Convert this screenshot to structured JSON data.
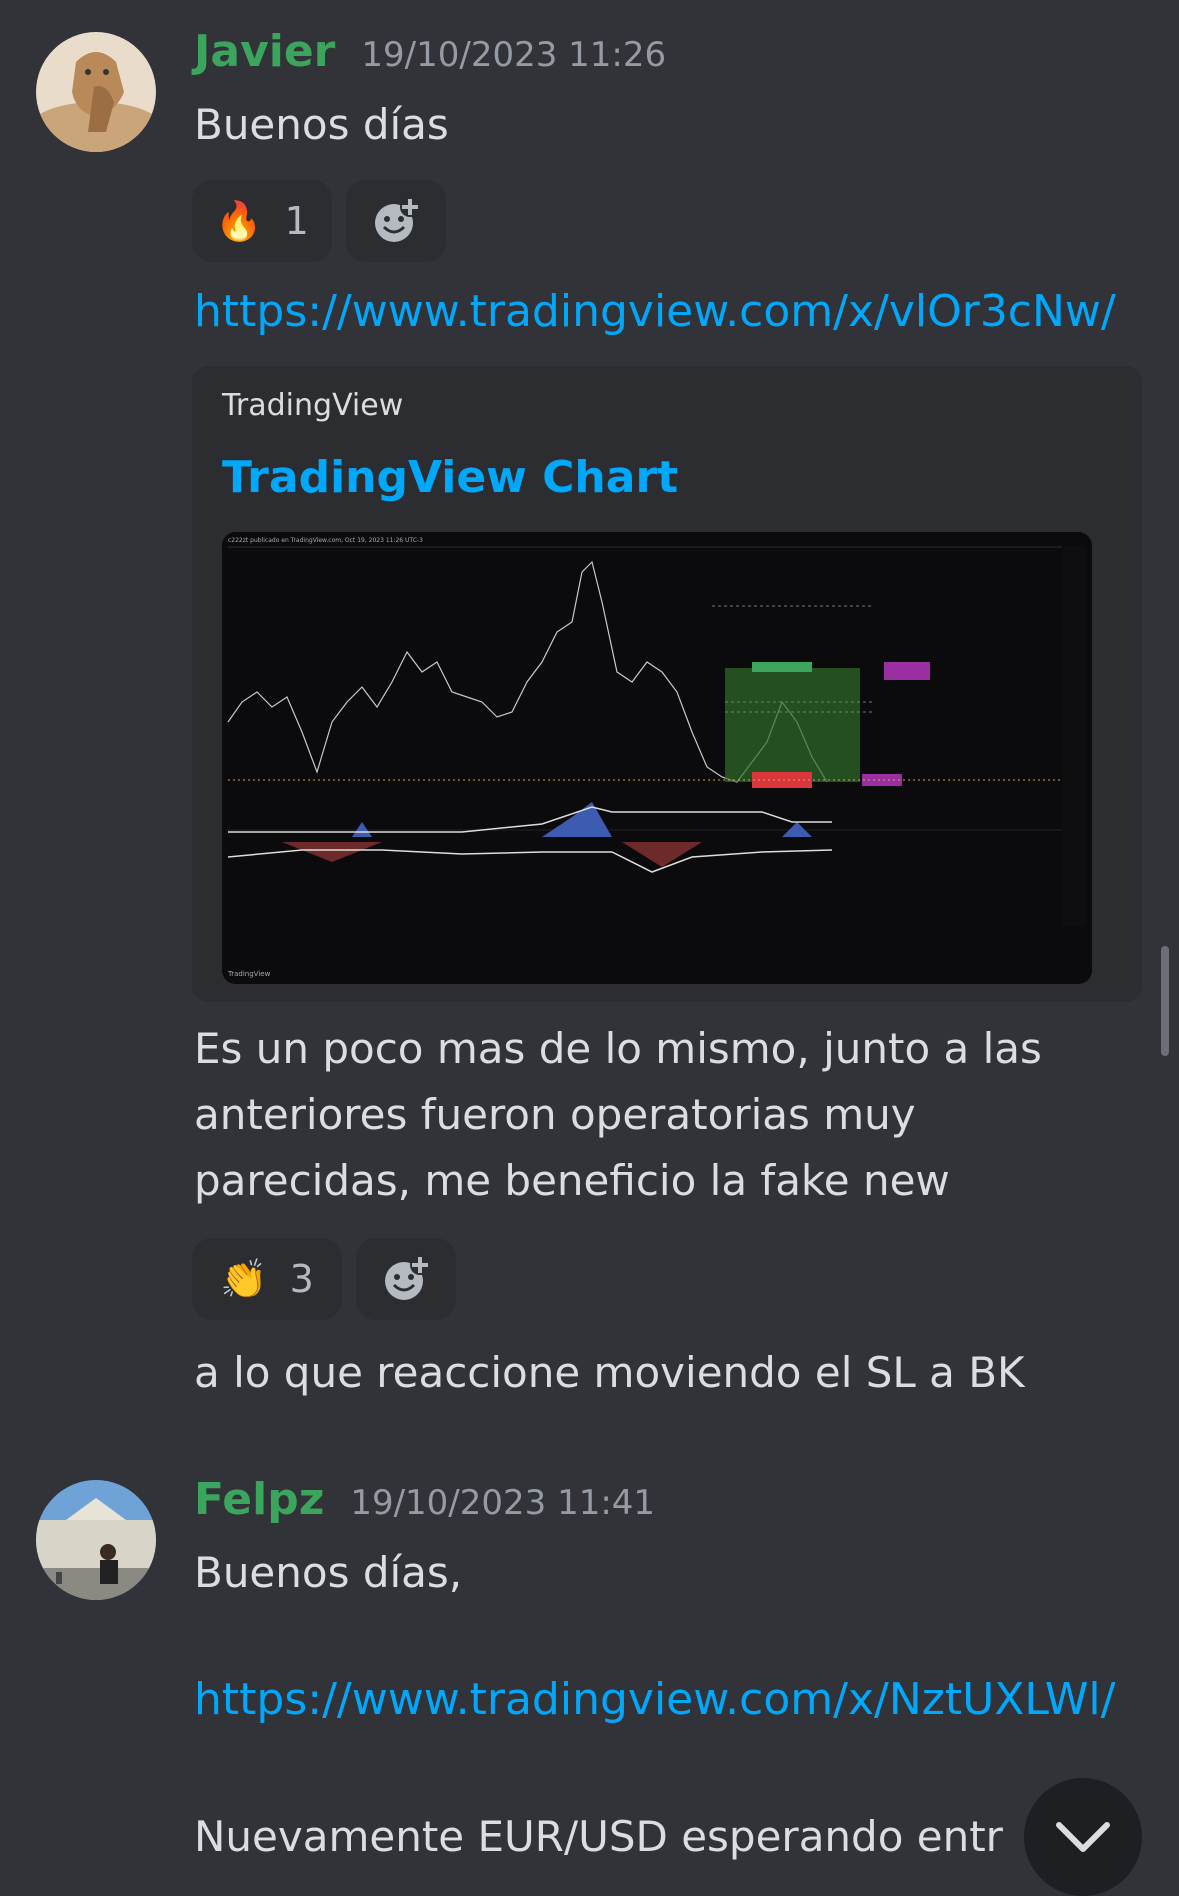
{
  "messages": [
    {
      "author": "Javier",
      "timestamp": "19/10/2023 11:26",
      "text": "Buenos días",
      "reaction": {
        "emoji": "🔥",
        "count": "1"
      },
      "link": "https://www.tradingview.com/x/vlOr3cNw/",
      "embed": {
        "provider": "TradingView",
        "title": "TradingView Chart",
        "chart_header": "c222zt publicado en TradingView.com, Oct 19, 2023 11:26 UTC-3",
        "footer": "TradingView"
      },
      "text2_lines": [
        "Es un poco mas de lo mismo, junto a las",
        "anteriores fueron operatorias muy",
        "parecidas, me beneficio la fake new"
      ],
      "reaction2": {
        "emoji": "👏",
        "count": "3"
      },
      "text3": "a lo que reaccione moviendo el SL a BK"
    },
    {
      "author": "Felpz",
      "timestamp": "19/10/2023 11:41",
      "text": "Buenos días,",
      "link": "https://www.tradingview.com/x/NztUXLWl/",
      "text2": "Nuevamente EUR/USD esperando entr"
    }
  ],
  "icons": {
    "add_reaction": "add-reaction-icon",
    "jump": "chevron-down-icon"
  },
  "colors": {
    "background": "#313338",
    "author": "#3ba55d",
    "link": "#00a8fc"
  }
}
